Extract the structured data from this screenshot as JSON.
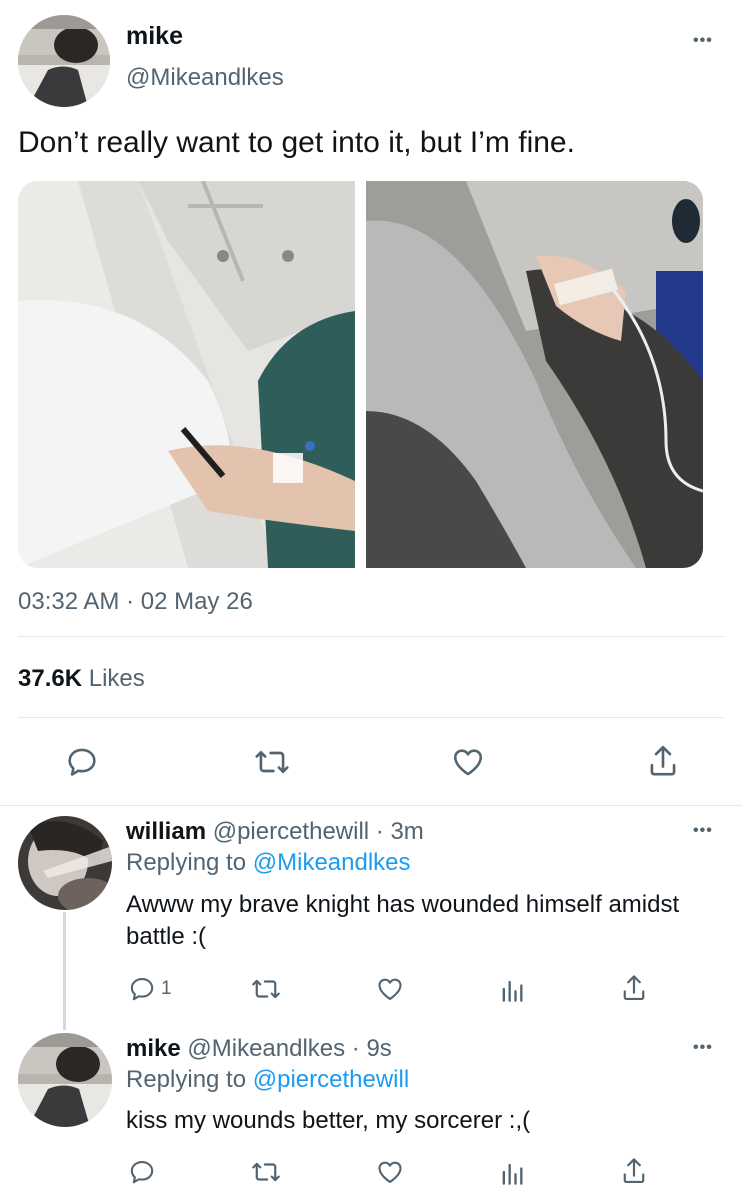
{
  "tweet": {
    "author_name": "mike",
    "author_handle": "@Mikeandlkes",
    "text": "Don’t really want to get into it, but I’m fine.",
    "timestamp": "03:32 AM · 02 May 26",
    "likes_count": "37.6K",
    "likes_label": "Likes"
  },
  "icons": {
    "more": "more-horizontal-icon",
    "reply": "speech-bubble-icon",
    "retweet": "retweet-icon",
    "like": "heart-icon",
    "share": "share-upload-icon",
    "analytics": "bar-chart-icon"
  },
  "more_label": "•••",
  "replies": [
    {
      "name": "william",
      "meta": "@piercethewill · 3m",
      "replying_prefix": "Replying to",
      "replying_to": "@Mikeandlkes",
      "text": "Awww my brave knight has wounded himself amidst battle :(",
      "reply_count": "1"
    },
    {
      "name": "mike",
      "meta": "@Mikeandlkes · 9s",
      "replying_prefix": "Replying to",
      "replying_to": "@piercethewill",
      "text": "kiss my wounds better, my sorcerer :,(",
      "reply_count": ""
    }
  ],
  "colors": {
    "text": "#0f1419",
    "secondary": "#536471",
    "link": "#1d9bf0",
    "divider": "#e6e9ec"
  }
}
